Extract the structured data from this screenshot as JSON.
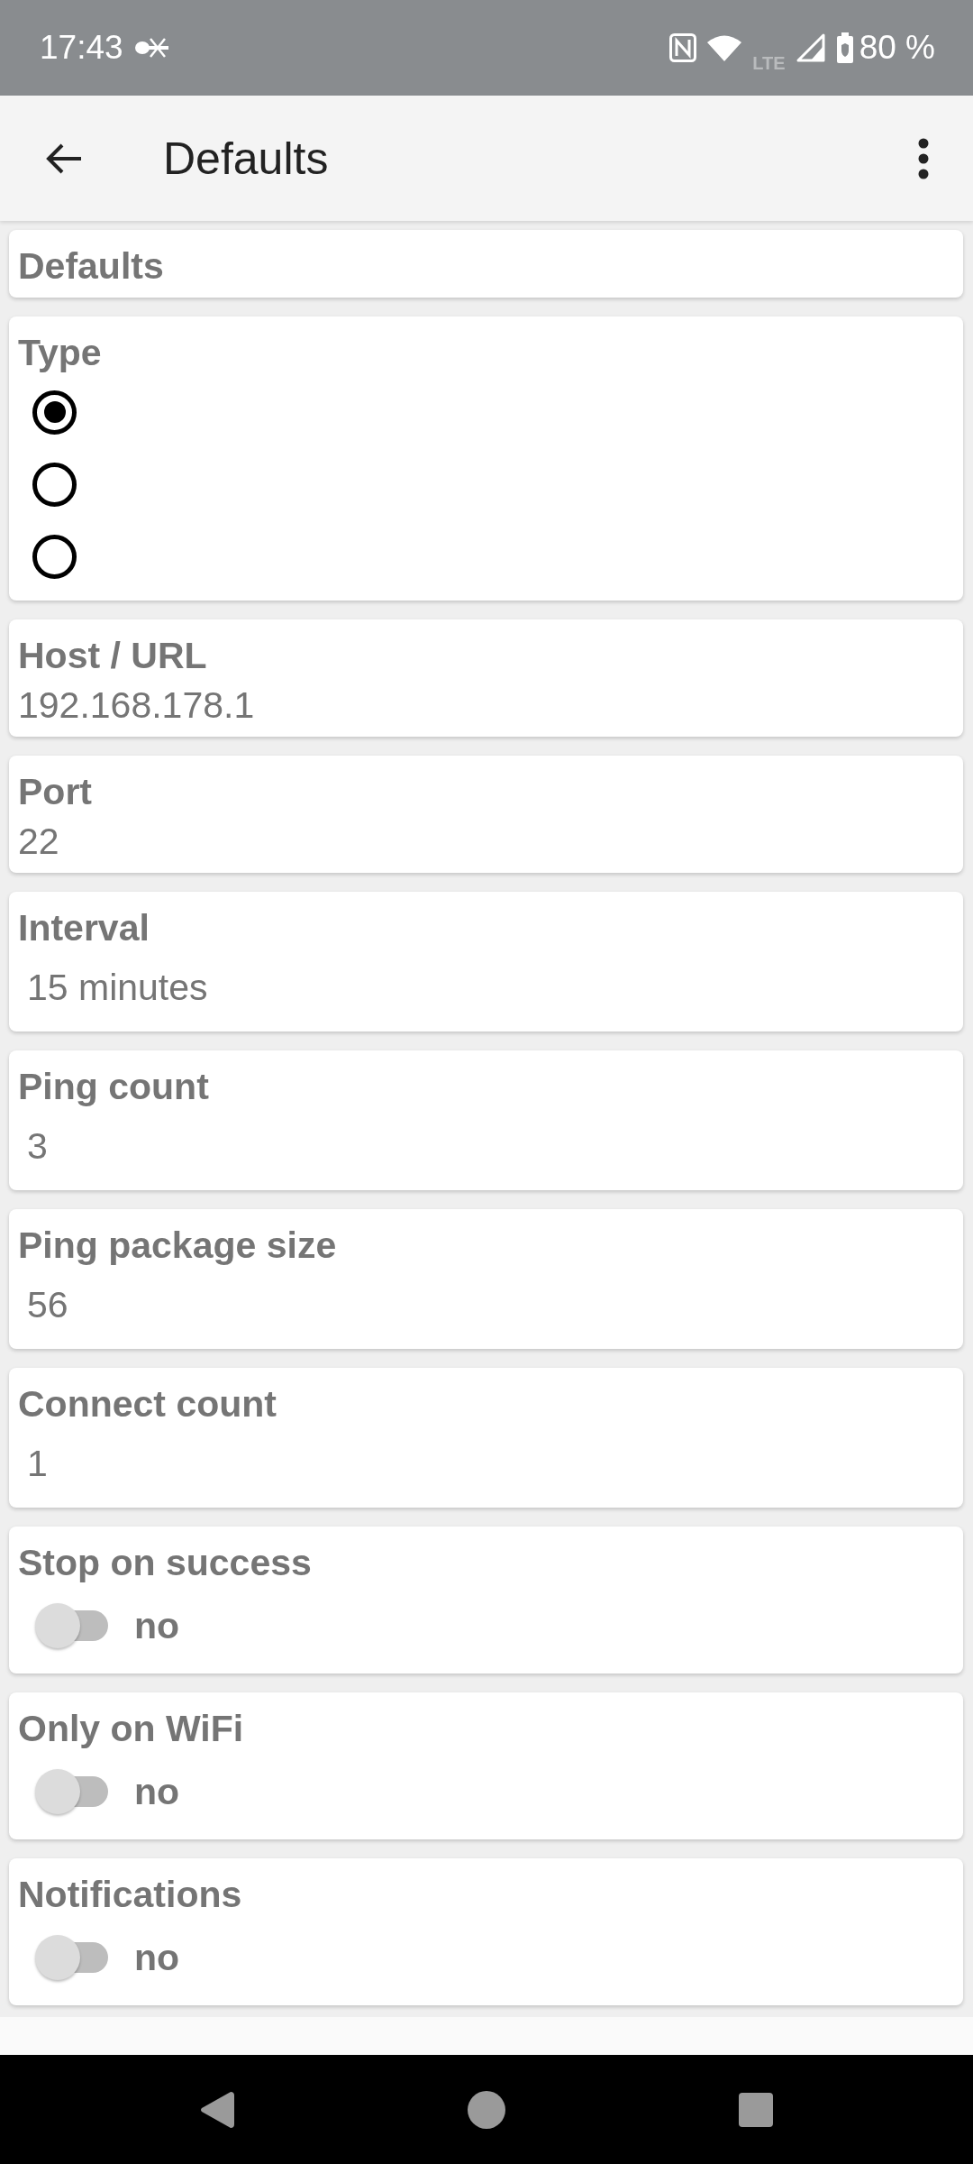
{
  "status_bar": {
    "time": "17:43",
    "network": "LTE",
    "battery": "80 %"
  },
  "app_bar": {
    "title": "Defaults"
  },
  "sections": [
    {
      "kind": "header",
      "label": "Defaults"
    },
    {
      "kind": "radio",
      "label": "Type",
      "options": [
        {
          "selected": true
        },
        {
          "selected": false
        },
        {
          "selected": false
        }
      ]
    },
    {
      "kind": "text",
      "label": "Host / URL",
      "value": "192.168.178.1"
    },
    {
      "kind": "text",
      "label": "Port",
      "value": "22"
    },
    {
      "kind": "spinner",
      "label": "Interval",
      "value": "15 minutes"
    },
    {
      "kind": "spinner",
      "label": "Ping count",
      "value": "3"
    },
    {
      "kind": "spinner",
      "label": "Ping package size",
      "value": "56"
    },
    {
      "kind": "spinner",
      "label": "Connect count",
      "value": "1"
    },
    {
      "kind": "switch",
      "label": "Stop on success",
      "on": false,
      "value": "no"
    },
    {
      "kind": "switch",
      "label": "Only on WiFi",
      "on": false,
      "value": "no"
    },
    {
      "kind": "switch",
      "label": "Notifications",
      "on": false,
      "value": "no"
    }
  ]
}
